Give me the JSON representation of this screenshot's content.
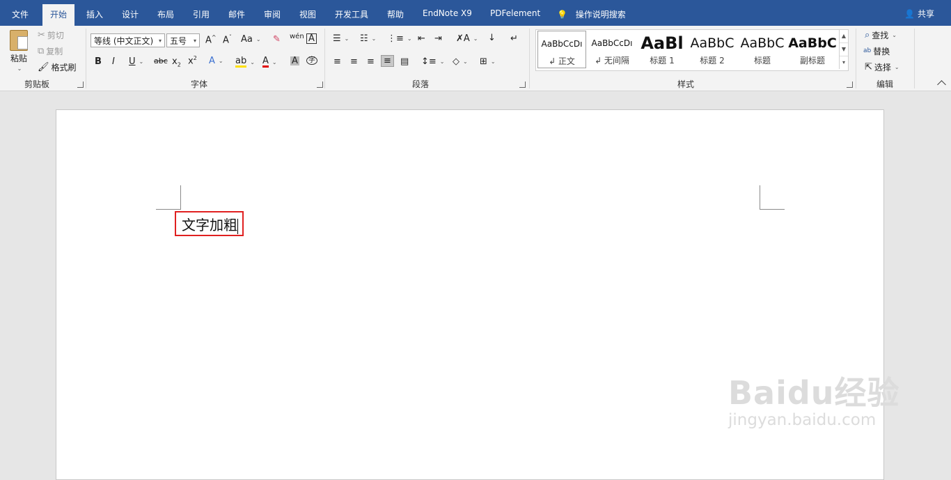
{
  "tabs": [
    {
      "label": "文件"
    },
    {
      "label": "开始"
    },
    {
      "label": "插入"
    },
    {
      "label": "设计"
    },
    {
      "label": "布局"
    },
    {
      "label": "引用"
    },
    {
      "label": "邮件"
    },
    {
      "label": "审阅"
    },
    {
      "label": "视图"
    },
    {
      "label": "开发工具"
    },
    {
      "label": "帮助"
    },
    {
      "label": "EndNote X9"
    },
    {
      "label": "PDFelement"
    }
  ],
  "tell_me": "操作说明搜索",
  "share": "共享",
  "clipboard": {
    "paste": "粘贴",
    "cut": "剪切",
    "copy": "复制",
    "format_painter": "格式刷",
    "group": "剪贴板"
  },
  "font": {
    "name": "等线 (中文正文)",
    "size": "五号",
    "group": "字体"
  },
  "paragraph": {
    "group": "段落"
  },
  "styles": {
    "items": [
      {
        "sample": "AaBbCcDı",
        "name": "↲ 正文"
      },
      {
        "sample": "AaBbCcDı",
        "name": "↲ 无间隔"
      },
      {
        "sample": "AaBl",
        "name": "标题 1"
      },
      {
        "sample": "AaBbC",
        "name": "标题 2"
      },
      {
        "sample": "AaBbC",
        "name": "标题"
      },
      {
        "sample": "AaBbC",
        "name": "副标题"
      }
    ],
    "group": "样式"
  },
  "editing": {
    "find": "查找",
    "replace": "替换",
    "select": "选择",
    "group": "编辑"
  },
  "document": {
    "text": "文字加粗"
  },
  "watermark": {
    "line1": "Baidu经验",
    "line2": "jingyan.baidu.com"
  },
  "colors": {
    "accent": "#2b579a",
    "highlight_box": "#e02020"
  }
}
